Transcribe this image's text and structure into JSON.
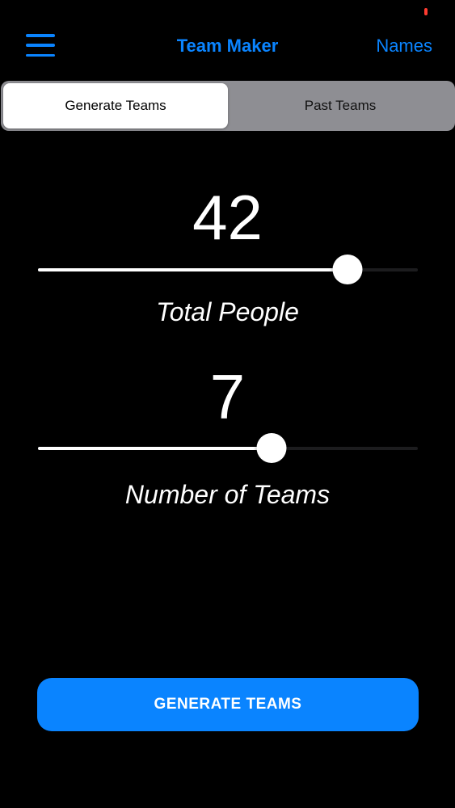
{
  "colors": {
    "accent": "#0a84ff",
    "background": "#000000",
    "segmented_bg": "#8e8e93",
    "track": "#1c1c1e",
    "fill": "#ffffff",
    "status_indicator": "#ff3b30"
  },
  "nav": {
    "menu_icon": "hamburger-menu-icon",
    "title": "Team Maker",
    "names_label": "Names"
  },
  "tabs": [
    {
      "label": "Generate Teams",
      "selected": true
    },
    {
      "label": "Past Teams",
      "selected": false
    }
  ],
  "total_people": {
    "value": "42",
    "label": "Total People",
    "slider_fraction": 0.815
  },
  "number_of_teams": {
    "value": "7",
    "label": "Number of Teams",
    "slider_fraction": 0.615
  },
  "generate_button": {
    "label": "GENERATE TEAMS"
  }
}
